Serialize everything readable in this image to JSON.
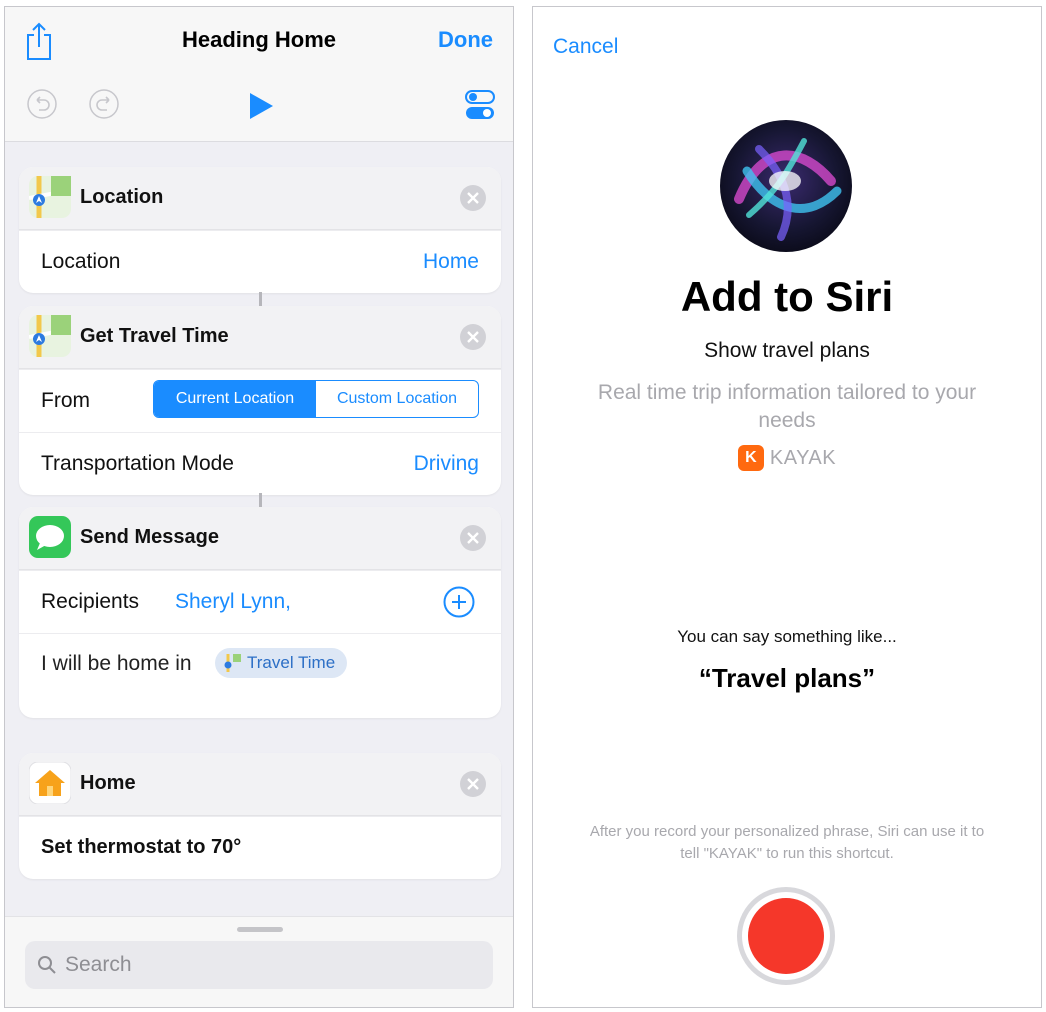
{
  "editor": {
    "title": "Heading Home",
    "done_label": "Done",
    "actions": {
      "location": {
        "title": "Location",
        "icon": "maps-icon",
        "row_label": "Location",
        "row_value": "Home"
      },
      "travel_time": {
        "title": "Get Travel Time",
        "icon": "maps-icon",
        "from_label": "From",
        "segments": [
          "Current Location",
          "Custom Location"
        ],
        "selected_segment": "Current Location",
        "mode_label": "Transportation Mode",
        "mode_value": "Driving"
      },
      "send_message": {
        "title": "Send Message",
        "icon": "messages-icon",
        "recipients_label": "Recipients",
        "recipient": "Sheryl Lynn,",
        "message_text": "I will be home in",
        "variable_token": "Travel Time"
      },
      "home": {
        "title": "Home",
        "icon": "home-app-icon",
        "action_text": "Set thermostat to 70°"
      }
    },
    "search": {
      "placeholder": "Search"
    },
    "colors": {
      "accent": "#1a8cff",
      "background": "#efeff4"
    }
  },
  "siri": {
    "cancel_label": "Cancel",
    "title": "Add to Siri",
    "subtitle": "Show travel plans",
    "description": "Real time trip information tailored to your needs",
    "app_icon_letter": "K",
    "app_name": "KAYAK",
    "hint": "You can say something like...",
    "phrase": "“Travel plans”",
    "footnote": "After you record your personalized phrase, Siri can use it to tell \"KAYAK\" to run this shortcut.",
    "colors": {
      "record": "#f5372a",
      "kayak": "#ff690f"
    }
  }
}
